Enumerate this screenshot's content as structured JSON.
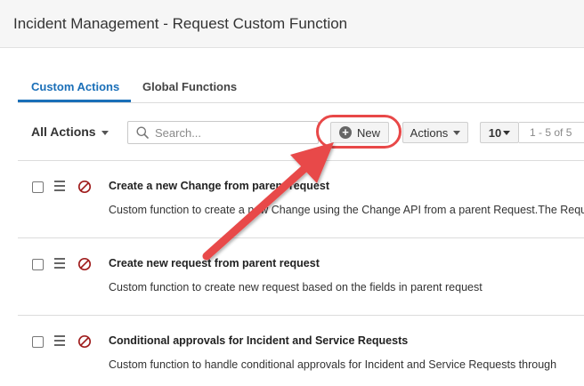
{
  "header": {
    "title": "Incident Management - Request Custom Function"
  },
  "tabs": [
    {
      "label": "Custom Actions",
      "active": true
    },
    {
      "label": "Global Functions",
      "active": false
    }
  ],
  "toolbar": {
    "filter_label": "All Actions",
    "search": {
      "placeholder": "Search...",
      "value": ""
    },
    "new_label": "New",
    "actions_label": "Actions",
    "page_size": "10",
    "pager_text": "1 - 5 of 5"
  },
  "rows": [
    {
      "name": "Create a new Change from parent request",
      "description": "Custom function to create a new Change using the Change API from a parent Request.The Request"
    },
    {
      "name": "Create new request from parent request",
      "description": "Custom function to create new request based on the fields in parent request"
    },
    {
      "name": "Conditional approvals for Incident and Service Requests",
      "description": "Custom function to handle conditional approvals for Incident and Service Requests through"
    }
  ],
  "colors": {
    "accent": "#1a6fb8",
    "annotation": "#e84848",
    "disabled": "#a01e1e"
  },
  "icons": [
    "search-icon",
    "plus-circle-icon",
    "drag-handle-icon",
    "disabled-icon",
    "chevron-down-icon"
  ]
}
